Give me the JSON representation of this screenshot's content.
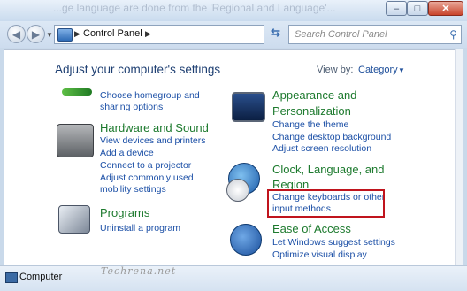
{
  "window": {
    "faded_title": "...ge language are done from the 'Regional and Language'...",
    "controls": {
      "minimize": "–",
      "maximize": "□",
      "close": "✕"
    }
  },
  "address": {
    "crumb": "Control Panel",
    "search_placeholder": "Search Control Panel"
  },
  "main": {
    "heading": "Adjust your computer's settings",
    "view_by_label": "View by:",
    "view_by_value": "Category"
  },
  "categories": {
    "network": {
      "links": [
        "Choose homegroup and",
        "sharing options"
      ]
    },
    "hardware": {
      "title": "Hardware and Sound",
      "links": [
        "View devices and printers",
        "Add a device",
        "Connect to a projector",
        "Adjust commonly used",
        "mobility settings"
      ]
    },
    "programs": {
      "title": "Programs",
      "links": [
        "Uninstall a program"
      ]
    },
    "appearance": {
      "title_line1": "Appearance and",
      "title_line2": "Personalization",
      "links": [
        "Change the theme",
        "Change desktop background",
        "Adjust screen resolution"
      ]
    },
    "clock": {
      "title_line1": "Clock, Language, and",
      "title_line2": "Region",
      "links": [
        "Change keyboards or other",
        "input methods"
      ]
    },
    "ease": {
      "title": "Ease of Access",
      "links": [
        "Let Windows suggest settings",
        "Optimize visual display"
      ]
    }
  },
  "status": {
    "label": "Computer"
  },
  "watermark": "Techrena.net",
  "colors": {
    "link": "#1b4fa6",
    "category_title": "#1d7a2e",
    "highlight_box": "#c0141d"
  }
}
